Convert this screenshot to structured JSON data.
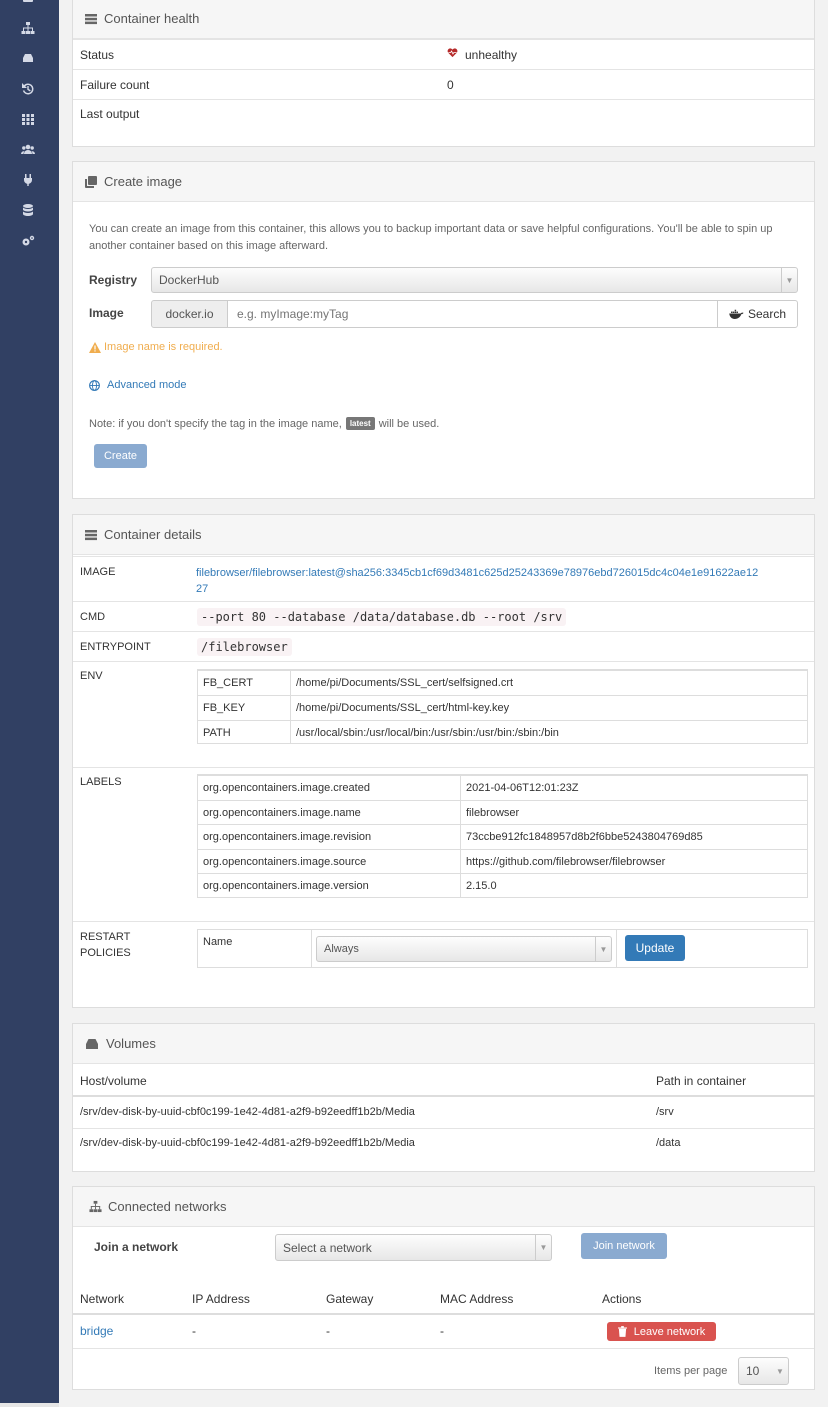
{
  "sidebar": {
    "icons": [
      "menu-icon",
      "sitemap-icon",
      "drive-icon",
      "history-icon",
      "grid-icon",
      "users-icon",
      "plug-icon",
      "database-icon",
      "cogs-icon"
    ]
  },
  "health": {
    "title": "Container health",
    "rows": [
      {
        "key": "Status",
        "value": "unhealthy"
      },
      {
        "key": "Failure count",
        "value": "0"
      },
      {
        "key": "Last output",
        "value": ""
      }
    ]
  },
  "create_image": {
    "title": "Create image",
    "description": "You can create an image from this container, this allows you to backup important data or save helpful configurations. You'll be able to spin up another container based on this image afterward.",
    "registry_label": "Registry",
    "registry_value": "DockerHub",
    "image_label": "Image",
    "image_prefix": "docker.io",
    "image_placeholder": "e.g. myImage:myTag",
    "search_label": "Search",
    "warning": "Image name is required.",
    "advanced_mode": "Advanced mode",
    "note_prefix": "Note: if you don't specify the tag in the image name,",
    "note_tag": "latest",
    "note_suffix": "will be used.",
    "create_label": "Create"
  },
  "details": {
    "title": "Container details",
    "image_label": "IMAGE",
    "image_value_line1": "filebrowser/filebrowser:latest@sha256:3345cb1cf69d3481c625d25243369e78976ebd726015dc4c04e1e91622ae12",
    "image_value_line2": "27",
    "cmd_label": "CMD",
    "cmd_value": "--port 80 --database /data/database.db --root /srv",
    "entrypoint_label": "ENTRYPOINT",
    "entrypoint_value": "/filebrowser",
    "env_label": "ENV",
    "env": [
      {
        "key": "FB_CERT",
        "value": "/home/pi/Documents/SSL_cert/selfsigned.crt"
      },
      {
        "key": "FB_KEY",
        "value": "/home/pi/Documents/SSL_cert/html-key.key"
      },
      {
        "key": "PATH",
        "value": "/usr/local/sbin:/usr/local/bin:/usr/sbin:/usr/bin:/sbin:/bin"
      }
    ],
    "labels_label": "LABELS",
    "labels": [
      {
        "key": "org.opencontainers.image.created",
        "value": "2021-04-06T12:01:23Z"
      },
      {
        "key": "org.opencontainers.image.name",
        "value": "filebrowser"
      },
      {
        "key": "org.opencontainers.image.revision",
        "value": "73ccbe912fc1848957d8b2f6bbe5243804769d85"
      },
      {
        "key": "org.opencontainers.image.source",
        "value": "https://github.com/filebrowser/filebrowser"
      },
      {
        "key": "org.opencontainers.image.version",
        "value": "2.15.0"
      }
    ],
    "restart_label_line1": "RESTART",
    "restart_label_line2": "POLICIES",
    "restart_name_label": "Name",
    "restart_value": "Always",
    "update_label": "Update"
  },
  "volumes": {
    "title": "Volumes",
    "col_host": "Host/volume",
    "col_path": "Path in container",
    "rows": [
      {
        "host": "/srv/dev-disk-by-uuid-cbf0c199-1e42-4d81-a2f9-b92eedff1b2b/Media",
        "path": "/srv"
      },
      {
        "host": "/srv/dev-disk-by-uuid-cbf0c199-1e42-4d81-a2f9-b92eedff1b2b/Media",
        "path": "/data"
      }
    ]
  },
  "networks": {
    "title": "Connected networks",
    "join_label": "Join a network",
    "select_placeholder": "Select a network",
    "join_button": "Join network",
    "columns": [
      "Network",
      "IP Address",
      "Gateway",
      "MAC Address",
      "Actions"
    ],
    "rows": [
      {
        "network": "bridge",
        "ip": "-",
        "gateway": "-",
        "mac": "-",
        "action": "Leave network"
      }
    ],
    "items_per_page_label": "Items per page",
    "items_per_page_value": "10"
  },
  "colors": {
    "sidebar": "#314063",
    "primary": "#337ab7",
    "danger": "#d9534f",
    "warning": "#f0ad4e",
    "code": "#c7254e"
  }
}
